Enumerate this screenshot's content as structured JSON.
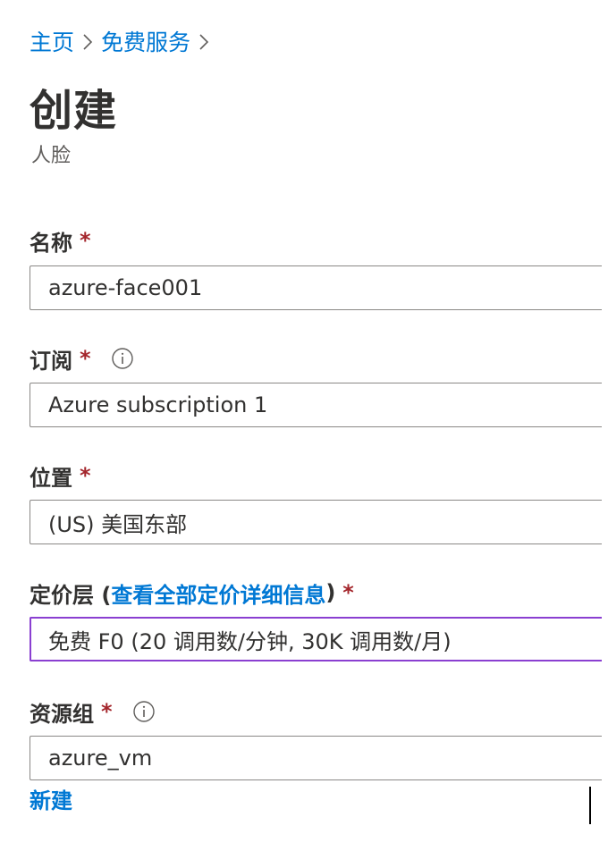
{
  "breadcrumb": {
    "items": [
      "主页",
      "免费服务"
    ]
  },
  "page": {
    "title": "创建",
    "subtitle": "人脸"
  },
  "fields": {
    "name": {
      "label": "名称",
      "required_mark": "*",
      "value": "azure-face001"
    },
    "subscription": {
      "label": "订阅",
      "required_mark": "*",
      "has_info_icon": true,
      "value": "Azure subscription 1"
    },
    "location": {
      "label": "位置",
      "required_mark": "*",
      "value": "(US) 美国东部"
    },
    "pricing_tier": {
      "label_prefix": "定价层 (",
      "label_link": "查看全部定价详细信息",
      "label_suffix": ")",
      "required_mark": "*",
      "value": "免费 F0 (20 调用数/分钟, 30K 调用数/月)"
    },
    "resource_group": {
      "label": "资源组",
      "required_mark": "*",
      "has_info_icon": true,
      "value": "azure_vm",
      "create_new_label": "新建"
    }
  },
  "colors": {
    "link": "#0078d4",
    "required": "#a4262c",
    "focus_border": "#8a3fd1",
    "text": "#323130"
  }
}
